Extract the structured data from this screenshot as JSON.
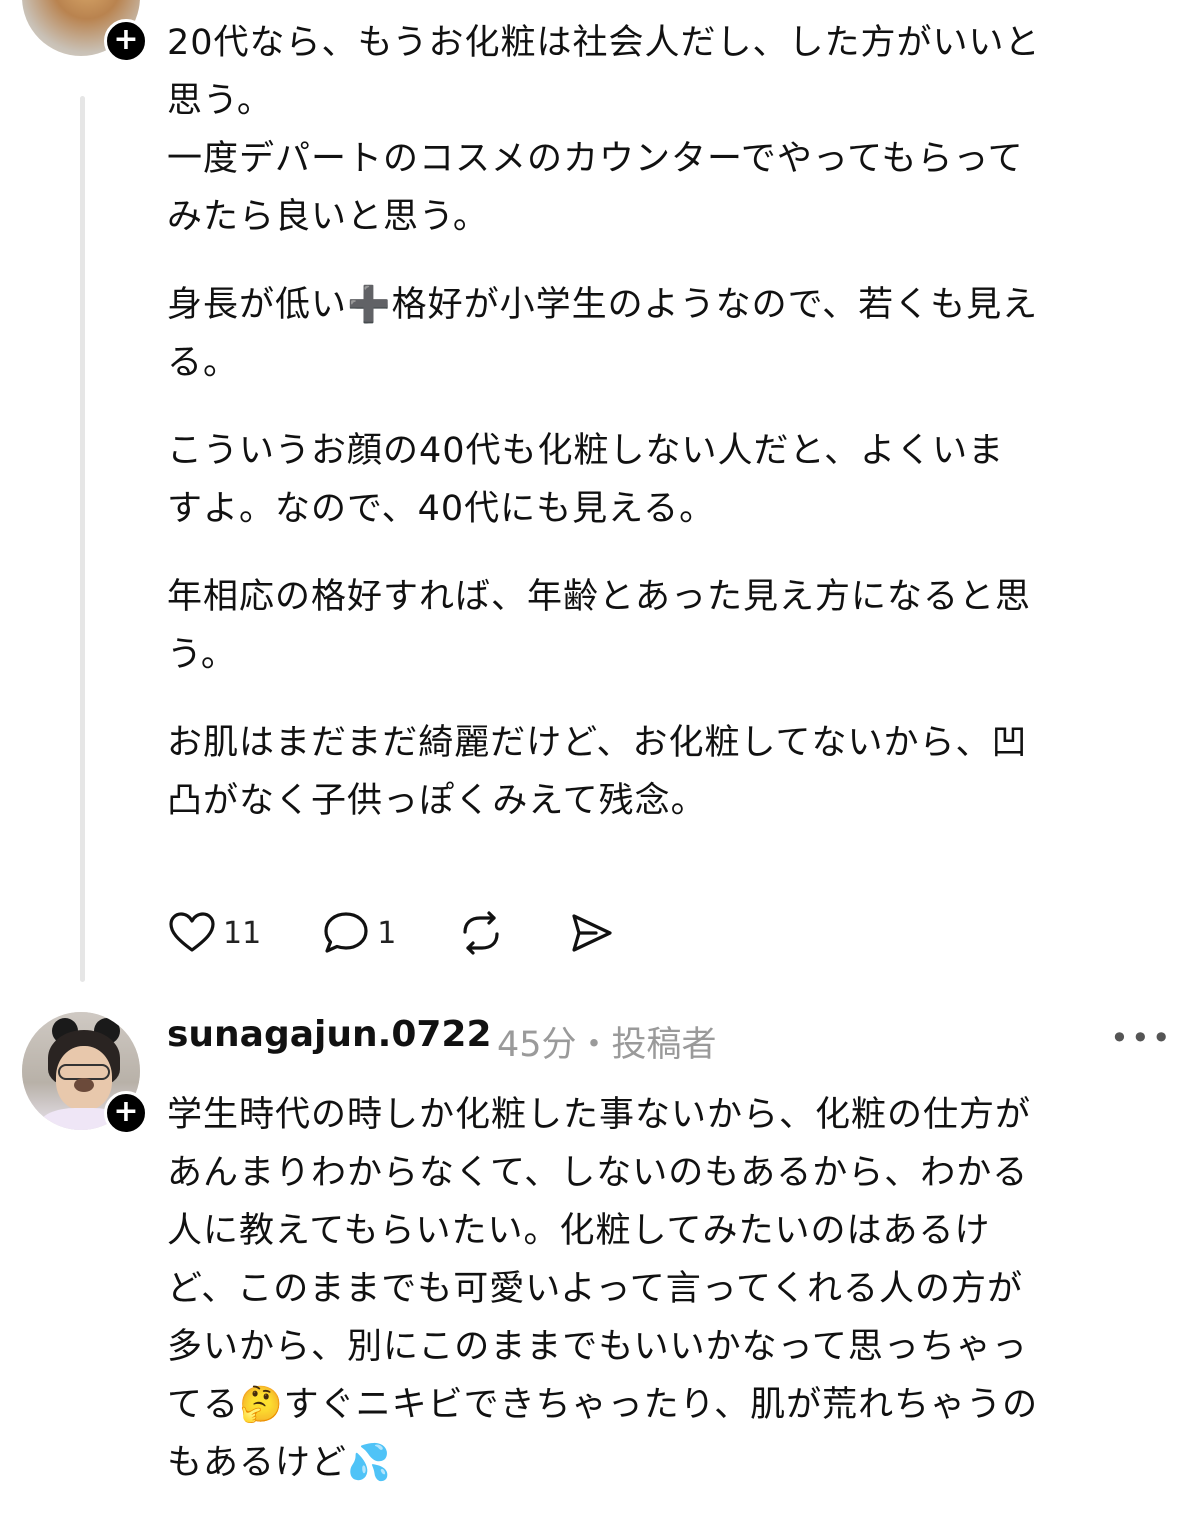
{
  "comment_top": {
    "paragraphs": [
      "20代なら、もうお化粧は社会人だし、した方がいいと\n思う。\n一度デパートのコスメのカウンターでやってもらって\nみたら良いと思う。",
      "身長が低い➕格好が小学生のようなので、若くも見え\nる。",
      "こういうお顔の40代も化粧しない人だと、よくいま\nすよ。なので、40代にも見える。",
      "年相応の格好すれば、年齢とあった見え方になると思\nう。",
      "お肌はまだまだ綺麗だけど、お化粧してないから、凹\n凸がなく子供っぽくみえて残念。"
    ],
    "like_count": "11",
    "reply_count": "1",
    "icons": {
      "like": "heart-icon",
      "reply": "comment-bubble-icon",
      "repost": "repost-icon",
      "share": "send-icon",
      "follow": "plus-icon"
    }
  },
  "comment_bottom": {
    "username": "sunagajun.0722",
    "meta": "45分・投稿者",
    "text": "学生時代の時しか化粧した事ないから、化粧の仕方が\nあんまりわからなくて、しないのもあるから、わかる\n人に教えてもらいたい。化粧してみたいのはあるけ\nど、このままでも可愛いよって言ってくれる人の方が\n多いから、別にこのままでもいいかなって思っちゃっ\nてる🤔すぐニキビできちゃったり、肌が荒れちゃうの\nもあるけど💦",
    "icons": {
      "more": "more-options-icon",
      "follow": "plus-icon"
    }
  },
  "colors": {
    "text": "#111111",
    "meta": "#9a9a9a",
    "thread_line": "#e6e6e6",
    "badge": "#000000"
  }
}
